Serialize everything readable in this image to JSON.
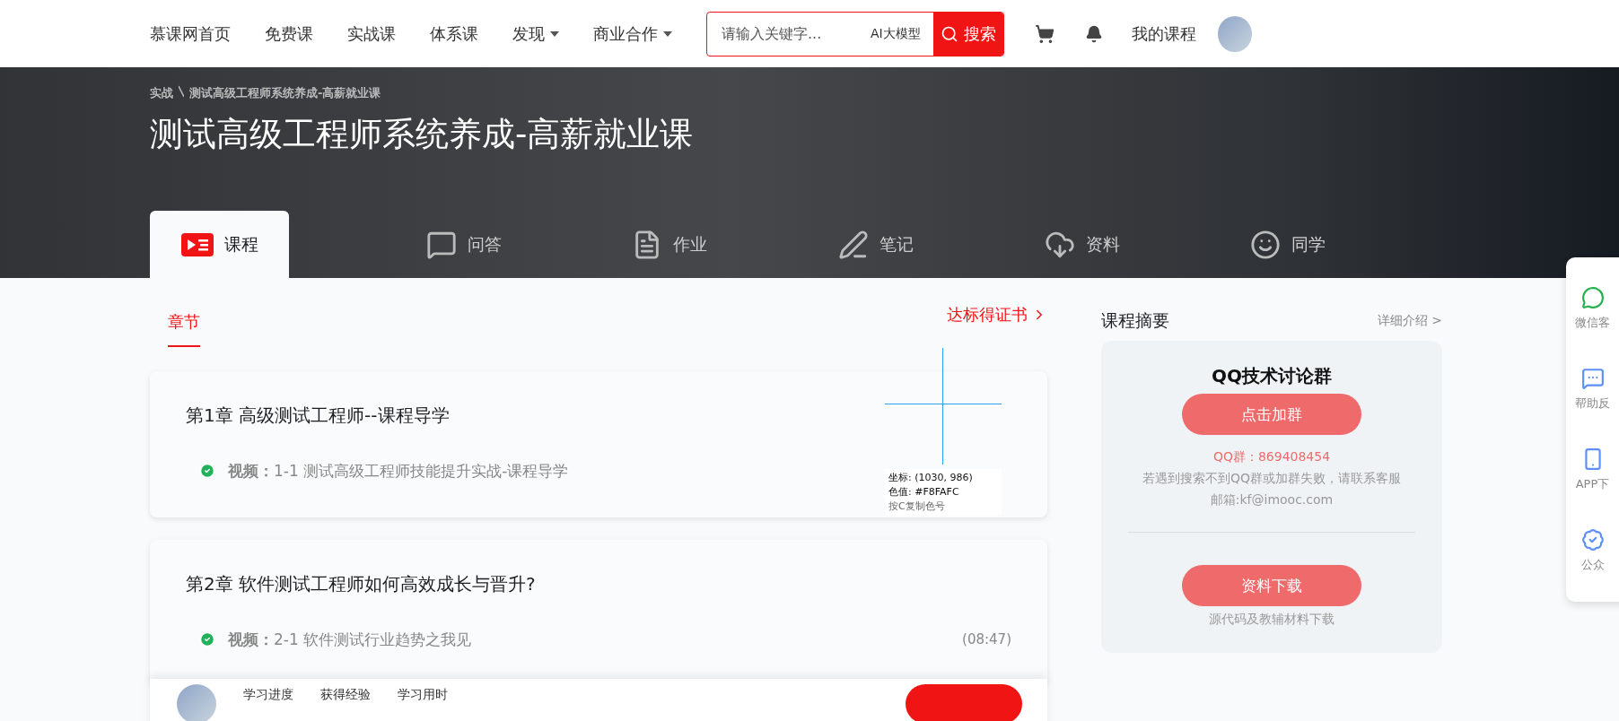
{
  "nav": {
    "links": [
      {
        "label": "慕课网首页",
        "dropdown": false
      },
      {
        "label": "免费课",
        "dropdown": false
      },
      {
        "label": "实战课",
        "dropdown": false
      },
      {
        "label": "体系课",
        "dropdown": false
      },
      {
        "label": "发现",
        "dropdown": true
      },
      {
        "label": "商业合作",
        "dropdown": true
      }
    ],
    "search": {
      "placeholder": "请输入关键字...",
      "ai_label": "AI大模型",
      "button": "搜索"
    },
    "my_courses": "我的课程"
  },
  "banner": {
    "breadcrumb": [
      "实战",
      "测试高级工程师系统养成-高薪就业课"
    ],
    "title": "测试高级工程师系统养成-高薪就业课",
    "tabs": [
      {
        "label": "课程",
        "kind": "course",
        "selected": true
      },
      {
        "label": "问答",
        "kind": "qa",
        "selected": false
      },
      {
        "label": "作业",
        "kind": "homework",
        "selected": false
      },
      {
        "label": "笔记",
        "kind": "notes",
        "selected": false
      },
      {
        "label": "资料",
        "kind": "files",
        "selected": false
      },
      {
        "label": "同学",
        "kind": "classmates",
        "selected": false
      }
    ]
  },
  "syllabus": {
    "section_tab": {
      "label": "章节",
      "selected": true
    },
    "certificate_link": "达标得证书",
    "chapters": [
      {
        "title": "第1章 高级测试工程师--课程导学",
        "lessons": [
          {
            "type_label": "视频：",
            "title": "1-1 测试高级工程师技能提升实战-课程导学",
            "done": true
          }
        ]
      },
      {
        "title": "第2章 软件测试工程师如何高效成长与晋升?",
        "lessons": [
          {
            "type_label": "视频：",
            "title": "2-1 软件测试行业趋势之我见",
            "duration": "(08:47)",
            "done": true
          }
        ]
      }
    ]
  },
  "summary": {
    "title": "课程摘要",
    "detail_link": "详细介绍 >",
    "card": {
      "title": "QQ技术讨论群",
      "join_button": "点击加群",
      "qq_number": "QQ群：869408454",
      "note": "若遇到搜索不到QQ群或加群失败，请联系客服",
      "email": "邮箱:kf@imooc.com",
      "download_button": "资料下载",
      "download_note": "源代码及教辅材料下载"
    }
  },
  "side_float": {
    "items": [
      {
        "label": "微信客",
        "kind": "wechat"
      },
      {
        "label": "帮助反",
        "kind": "feedback"
      },
      {
        "label": "APP下",
        "kind": "app"
      },
      {
        "label": "公众",
        "kind": "official"
      }
    ]
  },
  "bottom_bar": {
    "stats": [
      "学习进度",
      "获得经验",
      "学习用时"
    ]
  },
  "color_picker": {
    "coords": "坐标: (1030, 986)",
    "color_reading": "色值: #F8FAFC",
    "hint": "按C复制色号"
  }
}
